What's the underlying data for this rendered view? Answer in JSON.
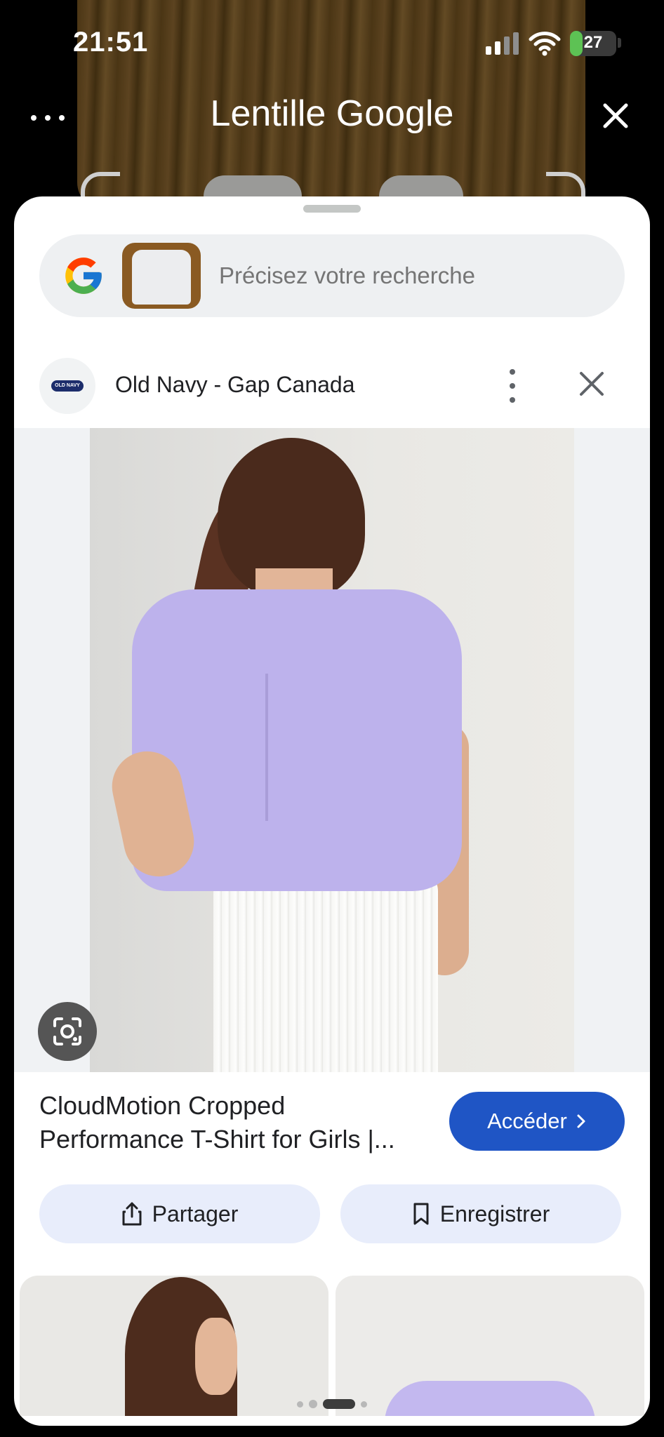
{
  "status_bar": {
    "time": "21:51",
    "battery": "27",
    "battery_level": 0.27
  },
  "header": {
    "title": "Lentille Google",
    "more_icon": "more-horiz-icon",
    "close_icon": "close-icon"
  },
  "search": {
    "placeholder": "Précisez votre recherche"
  },
  "result": {
    "site_name": "Old Navy - Gap Canada",
    "logo_text": "OLD NAVY",
    "product_title": "CloudMotion Cropped Performance T-Shirt for Girls |...",
    "visit_label": "Accéder",
    "share_label": "Partager",
    "save_label": "Enregistrer"
  },
  "colors": {
    "accent_button": "#1f55c5",
    "chip_bg": "#e8edfb",
    "shirt": "#bdb2ec"
  },
  "pagination": {
    "count": 4,
    "active_index": 2
  }
}
